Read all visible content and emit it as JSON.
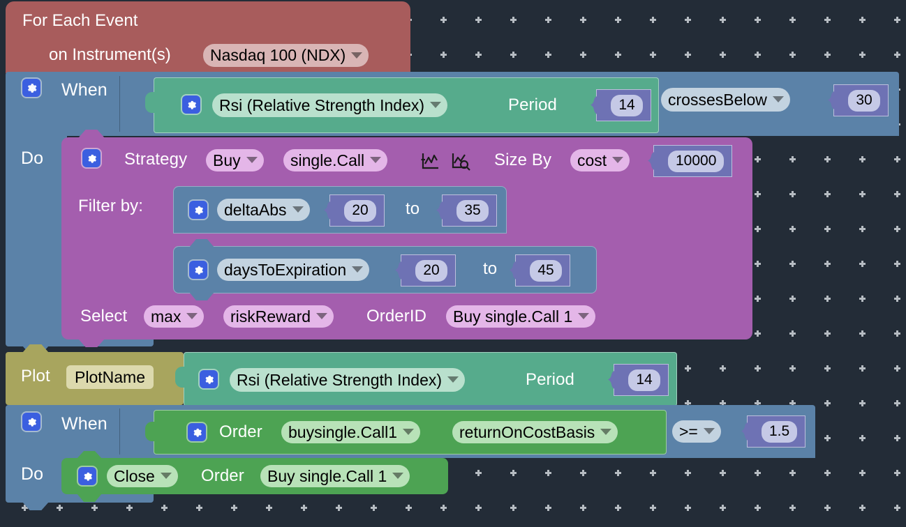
{
  "workspace": {
    "background_color": "#232c37",
    "grid_marker_color": "#b6bcc2"
  },
  "blocks": {
    "for_each_event": {
      "color": "#a85c5c",
      "title": "For Each Event",
      "instrument_label": "on Instrument(s)",
      "instrument_value": "Nasdaq 100 (NDX)",
      "field_color": "#d9b5b5"
    },
    "when_entry": {
      "color": "#5b82a8",
      "when_label": "When",
      "do_label": "Do",
      "gear_icon": "gear-icon"
    },
    "rsi_condition": {
      "color": "#56ab8c",
      "indicator": "Rsi (Relative Strength Index)",
      "period_label": "Period",
      "period_value": "14",
      "field_color": "#b9e0cd"
    },
    "comparison": {
      "operator": "crossesBelow",
      "threshold": "30",
      "field_color": "#c3d3e0"
    },
    "strategy": {
      "color": "#a45eae",
      "strategy_label": "Strategy",
      "action": "Buy",
      "structure": "single.Call",
      "plot_icon": "chart-plot-icon",
      "analyze_icon": "chart-magnifier-icon",
      "size_by_label": "Size By",
      "size_by_mode": "cost",
      "size_by_value": "10000",
      "field_color": "#e4b6e8",
      "filter_label": "Filter by:",
      "filters": [
        {
          "name": "deltaAbs",
          "from": "20",
          "to_label": "to",
          "to": "35"
        },
        {
          "name": "daysToExpiration",
          "from": "20",
          "to_label": "to",
          "to": "45"
        }
      ],
      "filter_color": "#5b82a8",
      "filter_field_color": "#c3d3e0",
      "select_label": "Select",
      "select_agg": "max",
      "select_metric": "riskReward",
      "orderid_label": "OrderID",
      "orderid_value": "Buy single.Call 1"
    },
    "plot": {
      "color": "#a8a55e",
      "plot_label": "Plot",
      "plot_name": "PlotName",
      "field_color": "#dcd9ad",
      "indicator": "Rsi (Relative Strength Index)",
      "indicator_color": "#56ab8c",
      "period_label": "Period",
      "period_value": "14"
    },
    "when_exit": {
      "color": "#5b82a8",
      "when_label": "When",
      "do_label": "Do",
      "order_label": "Order",
      "order_ref": "buysingle.Call1",
      "order_block_color": "#4da353",
      "metric": "returnOnCostBasis",
      "operator": ">=",
      "value": "1.5",
      "field_color": "#b8e2b8",
      "operator_field_color": "#c3d3e0",
      "close_action": "Close",
      "close_order_label": "Order",
      "close_order_ref": "Buy single.Call 1",
      "close_block_color": "#4da353"
    }
  }
}
